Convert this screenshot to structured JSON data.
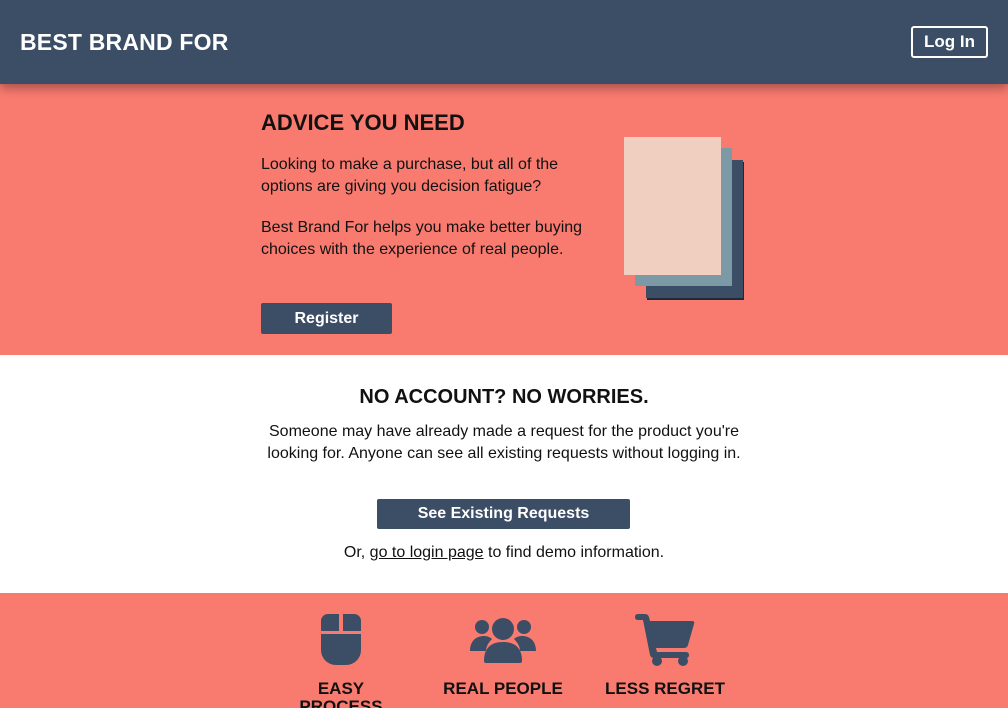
{
  "header": {
    "brand": "BEST BRAND FOR",
    "login_label": "Log In"
  },
  "hero": {
    "title": "ADVICE YOU NEED",
    "paragraph1": "Looking to make a purchase, but all of the options are giving you decision fatigue?",
    "paragraph2": "Best Brand For helps you make better buying choices with the experience of real people.",
    "register_label": "Register"
  },
  "middle": {
    "title": "NO ACCOUNT? NO WORRIES.",
    "text": "Someone may have already made a request for the product you're looking for. Anyone can see all existing requests without logging in.",
    "button_label": "See Existing Requests",
    "footer_prefix": "Or, ",
    "footer_link": "go to login page",
    "footer_suffix": " to find demo information."
  },
  "features": [
    {
      "icon": "mouse-icon",
      "label": "EASY PROCESS"
    },
    {
      "icon": "users-icon",
      "label": "REAL PEOPLE"
    },
    {
      "icon": "cart-icon",
      "label": "LESS REGRET"
    }
  ],
  "colors": {
    "navy": "#3c4e66",
    "coral": "#f97b6f",
    "paper_light": "#f0cfc1",
    "paper_mid": "#7c9aa6",
    "paper_dark": "#3c4e66"
  }
}
